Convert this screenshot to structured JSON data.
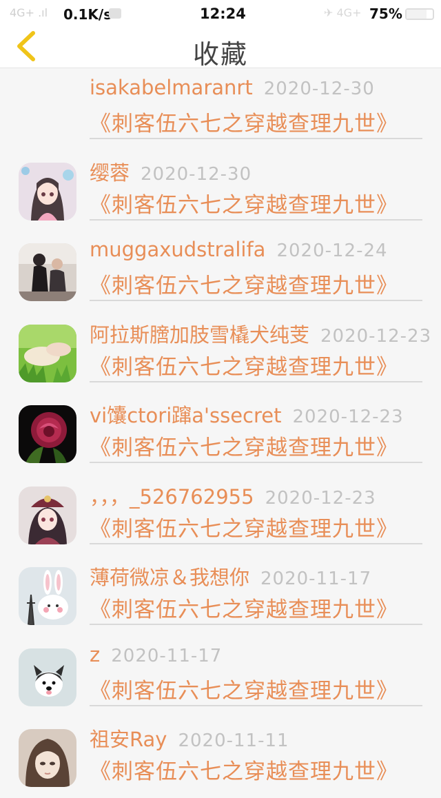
{
  "status_bar": {
    "signal": "4G+ .ıl",
    "net_speed": "0.1K/s",
    "time": "12:24",
    "right_icons": "✈ 4G+",
    "battery": "75%"
  },
  "header": {
    "title": "收藏",
    "back_icon": "chevron-left-icon",
    "accent_color": "#f0c419"
  },
  "items": [
    {
      "username": "isakabelmaranrt",
      "date": "2020-12-30",
      "book": "《刺客伍六七之穿越查理九世》",
      "avatar": "none"
    },
    {
      "username": "缨蓉",
      "date": "2020-12-30",
      "book": "《刺客伍六七之穿越查理九世》",
      "avatar": "anime-girl-pink"
    },
    {
      "username": "muggaxudstralifa",
      "date": "2020-12-24",
      "book": "《刺客伍六七之穿越查理九世》",
      "avatar": "couple-photo"
    },
    {
      "username": "阿拉斯膪加肢雪橇犬纯芰",
      "date": "2020-12-23",
      "book": "《刺客伍六七之穿越查理九世》",
      "avatar": "hand-grass"
    },
    {
      "username": "vi馕ctori蹿a'ssecret",
      "date": "2020-12-23",
      "book": "《刺客伍六七之穿越查理九世》",
      "avatar": "red-rose"
    },
    {
      "username": "，，，_526762955",
      "date": "2020-12-23",
      "book": "《刺客伍六七之穿越查理九世》",
      "avatar": "anime-girl-hat"
    },
    {
      "username": "薄荷微凉＆我想你",
      "date": "2020-11-17",
      "book": "《刺客伍六七之穿越查理九世》",
      "avatar": "white-rabbit"
    },
    {
      "username": "z",
      "date": "2020-11-17",
      "book": "《刺客伍六七之穿越查理九世》",
      "avatar": "husky-dog"
    },
    {
      "username": "祖安Ray",
      "date": "2020-11-11",
      "book": "《刺客伍六七之穿越查理九世》",
      "avatar": "anime-girl-bangs"
    }
  ]
}
